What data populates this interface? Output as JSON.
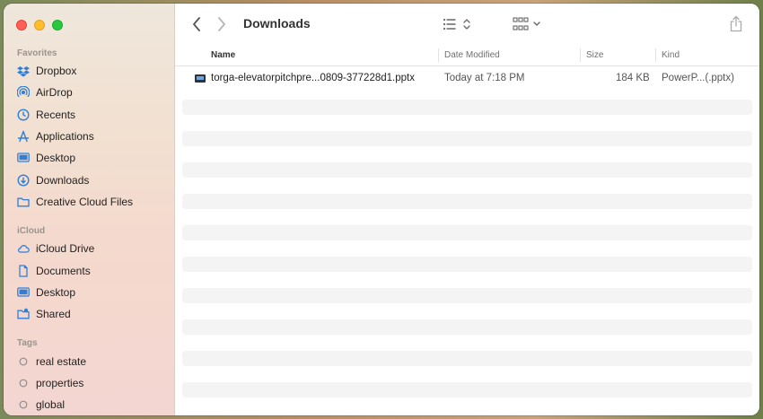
{
  "window": {
    "title": "Downloads"
  },
  "sidebar": {
    "sections": [
      {
        "title": "Favorites",
        "items": [
          {
            "label": "Dropbox",
            "icon": "dropbox-icon"
          },
          {
            "label": "AirDrop",
            "icon": "airdrop-icon"
          },
          {
            "label": "Recents",
            "icon": "clock-icon"
          },
          {
            "label": "Applications",
            "icon": "applications-icon"
          },
          {
            "label": "Desktop",
            "icon": "desktop-icon"
          },
          {
            "label": "Downloads",
            "icon": "download-icon"
          },
          {
            "label": "Creative Cloud Files",
            "icon": "folder-icon"
          }
        ]
      },
      {
        "title": "iCloud",
        "items": [
          {
            "label": "iCloud Drive",
            "icon": "cloud-icon"
          },
          {
            "label": "Documents",
            "icon": "document-icon"
          },
          {
            "label": "Desktop",
            "icon": "desktop-icon"
          },
          {
            "label": "Shared",
            "icon": "shared-folder-icon"
          }
        ]
      },
      {
        "title": "Tags",
        "items": [
          {
            "label": "real estate",
            "icon": "tag-circle-icon"
          },
          {
            "label": "properties",
            "icon": "tag-circle-icon"
          },
          {
            "label": "global",
            "icon": "tag-circle-icon"
          }
        ]
      }
    ]
  },
  "columns": {
    "name": "Name",
    "date": "Date Modified",
    "size": "Size",
    "kind": "Kind"
  },
  "files": [
    {
      "name": "torga-elevatorpitchpre...0809-377228d1.pptx",
      "date": "Today at 7:18 PM",
      "size": "184 KB",
      "kind": "PowerP...(.pptx)"
    }
  ],
  "colors": {
    "accent": "#2f7fd8",
    "sidebar_icon": "#2f7fd8",
    "tag_circle": "#8e8e8e"
  }
}
